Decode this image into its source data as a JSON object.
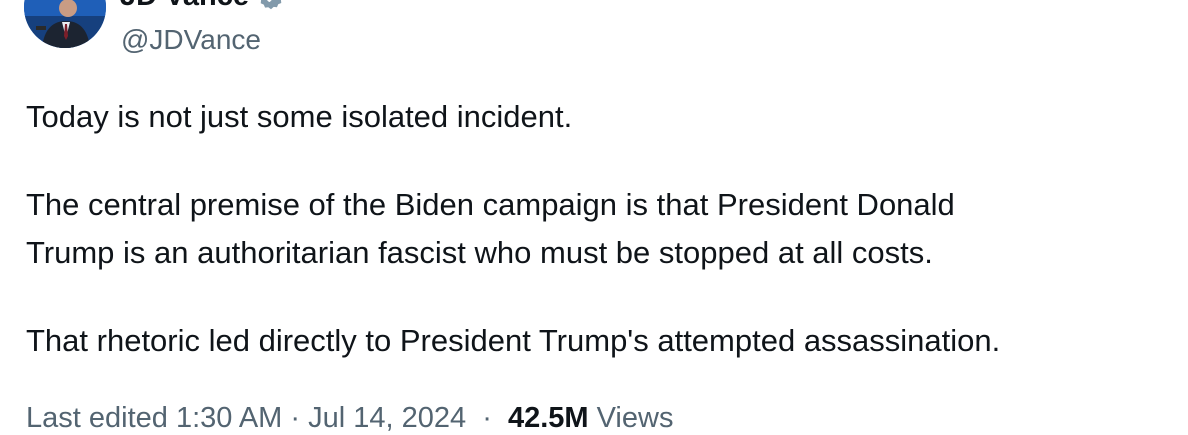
{
  "author": {
    "display_name": "JD Vance",
    "handle": "@JDVance",
    "verified_icon": "verified-badge-icon",
    "avatar_icon": "profile-photo",
    "accent_color": "#1d9bf0",
    "verified_color": "#829aab"
  },
  "tweet": {
    "paragraphs": [
      "Today is not just some isolated incident.",
      "The central premise of the Biden campaign is that President Donald\nTrump is an authoritarian fascist who must be stopped at all costs.",
      "That rhetoric led directly to President Trump's attempted assassination."
    ]
  },
  "meta": {
    "edited_time": "Last edited 1:30 AM · Jul 14, 2024",
    "separator": "·",
    "views_count": "42.5M",
    "views_label": "Views"
  },
  "menu": {
    "more_icon": "more-options-icon"
  }
}
